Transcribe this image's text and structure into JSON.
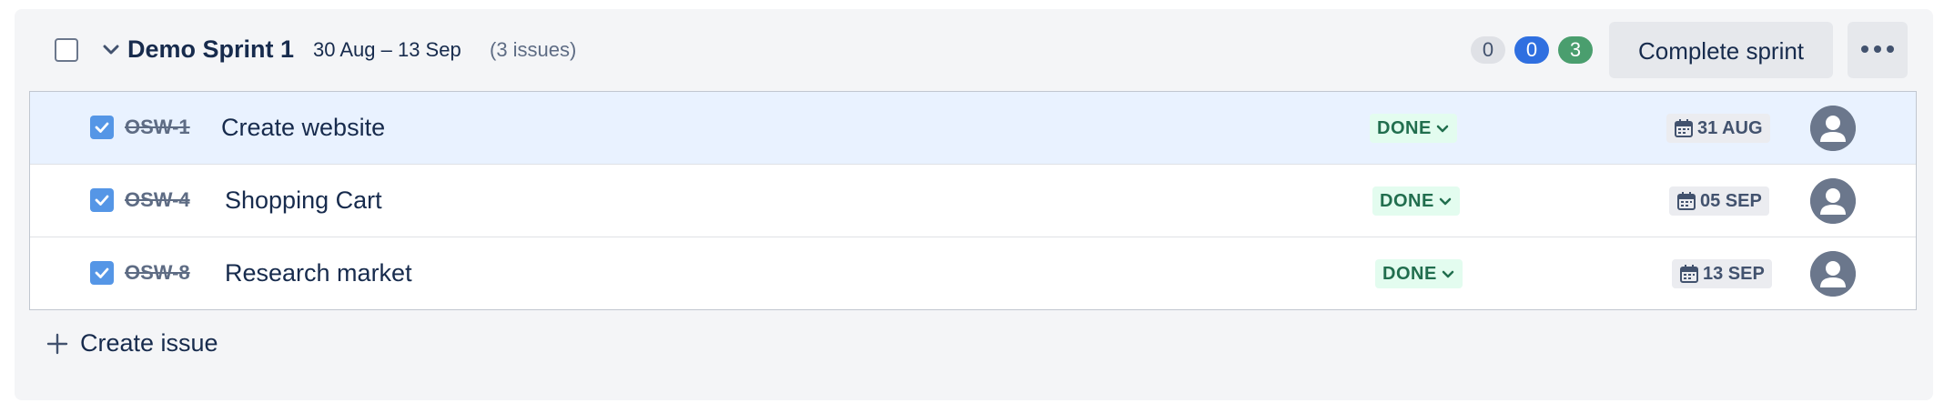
{
  "sprint": {
    "name": "Demo Sprint 1",
    "dates": "30 Aug – 13 Sep",
    "issue_count": "(3 issues)",
    "badges": {
      "todo": "0",
      "in_progress": "0",
      "done": "3"
    },
    "complete_label": "Complete sprint"
  },
  "issues": [
    {
      "key": "OSW-1",
      "summary": "Create website",
      "status": "DONE",
      "due": "31 AUG"
    },
    {
      "key": "OSW-4",
      "summary": "Shopping Cart",
      "status": "DONE",
      "due": "05 SEP"
    },
    {
      "key": "OSW-8",
      "summary": "Research market",
      "status": "DONE",
      "due": "13 SEP"
    }
  ],
  "create_issue_label": "Create issue",
  "colors": {
    "done_lozenge_bg": "#e3fcef",
    "done_lozenge_text": "#216e4e",
    "selected_row": "#e9f2ff",
    "checkbox_checked": "#5596e6"
  },
  "icons": {
    "chevron": "chevron-down-icon",
    "more": "more-icon",
    "calendar": "calendar-icon",
    "avatar": "user-avatar-icon",
    "plus": "plus-icon",
    "check": "check-icon"
  }
}
